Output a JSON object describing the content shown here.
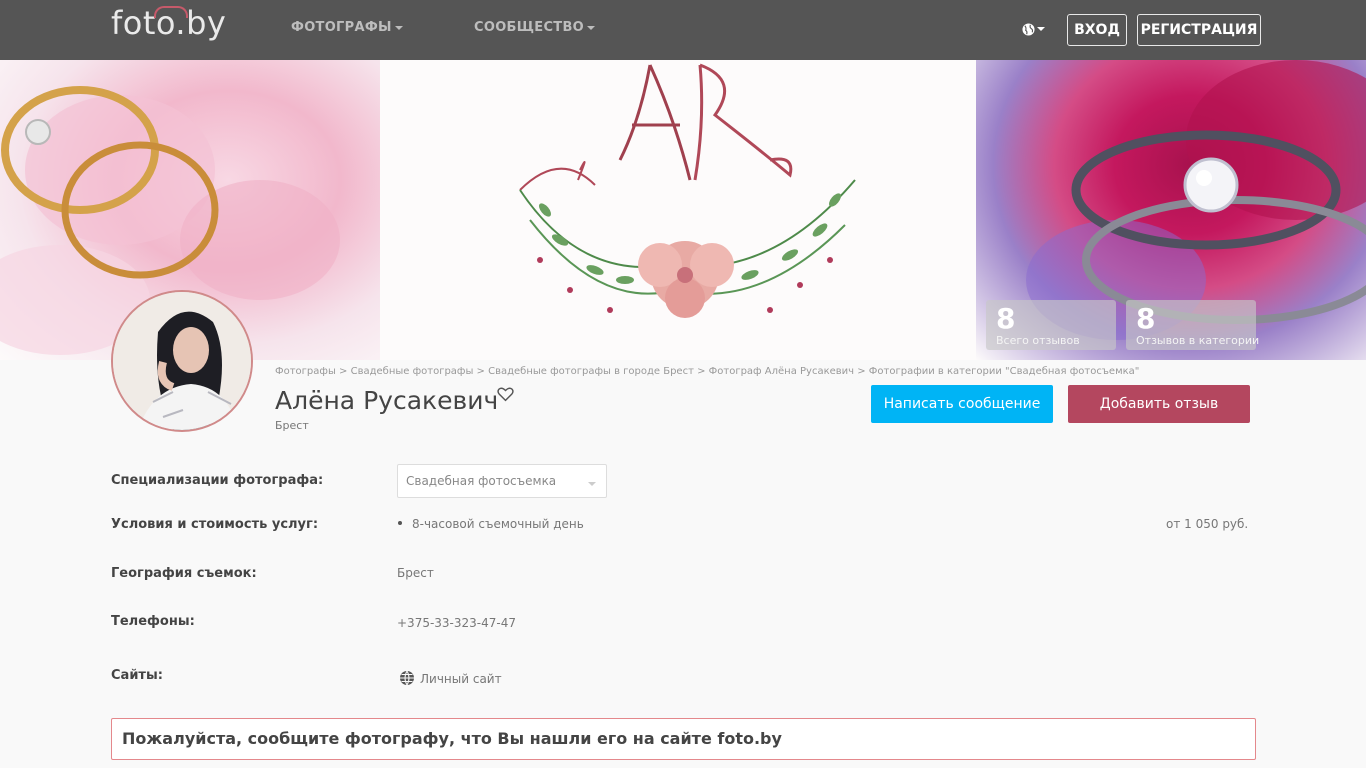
{
  "header": {
    "logo": "foto.by",
    "nav": [
      {
        "label": "ФОТОГРАФЫ"
      },
      {
        "label": "СООБЩЕСТВО"
      }
    ],
    "login_label": "ВХОД",
    "register_label": "РЕГИСТРАЦИЯ"
  },
  "stats": [
    {
      "value": "8",
      "label": "Всего отзывов"
    },
    {
      "value": "8",
      "label": "Отзывов в категории"
    }
  ],
  "breadcrumb": "Фотографы > Свадебные фотографы > Свадебные фотографы в городе Брест > Фотограф Алёна Русакевич > Фотографии в категории \"Свадебная фотосъемка\"",
  "profile": {
    "name": "Алёна Русакевич",
    "city": "Брест",
    "message_label": "Написать сообщение",
    "review_label": "Добавить отзыв"
  },
  "details": {
    "specializations_label": "Специализации фотографа:",
    "specialization_value": "Свадебная фотосъемка",
    "services_label": "Условия и стоимость услуг:",
    "service_name": "8-часовой съемочный день",
    "service_price": "от 1 050 руб.",
    "geography_label": "География съемок:",
    "geography_value": "Брест",
    "phones_label": "Телефоны:",
    "phone_value": "+375-33-323-47-47",
    "sites_label": "Сайты:",
    "site_value": "Личный сайт"
  },
  "notice": "Пожалуйста, сообщите фотографу, что Вы нашли его на сайте foto.by",
  "colors": {
    "header_bg": "#555555",
    "message_button": "#00b4f5",
    "review_button": "#b4475f",
    "notice_border": "#e4888c"
  }
}
